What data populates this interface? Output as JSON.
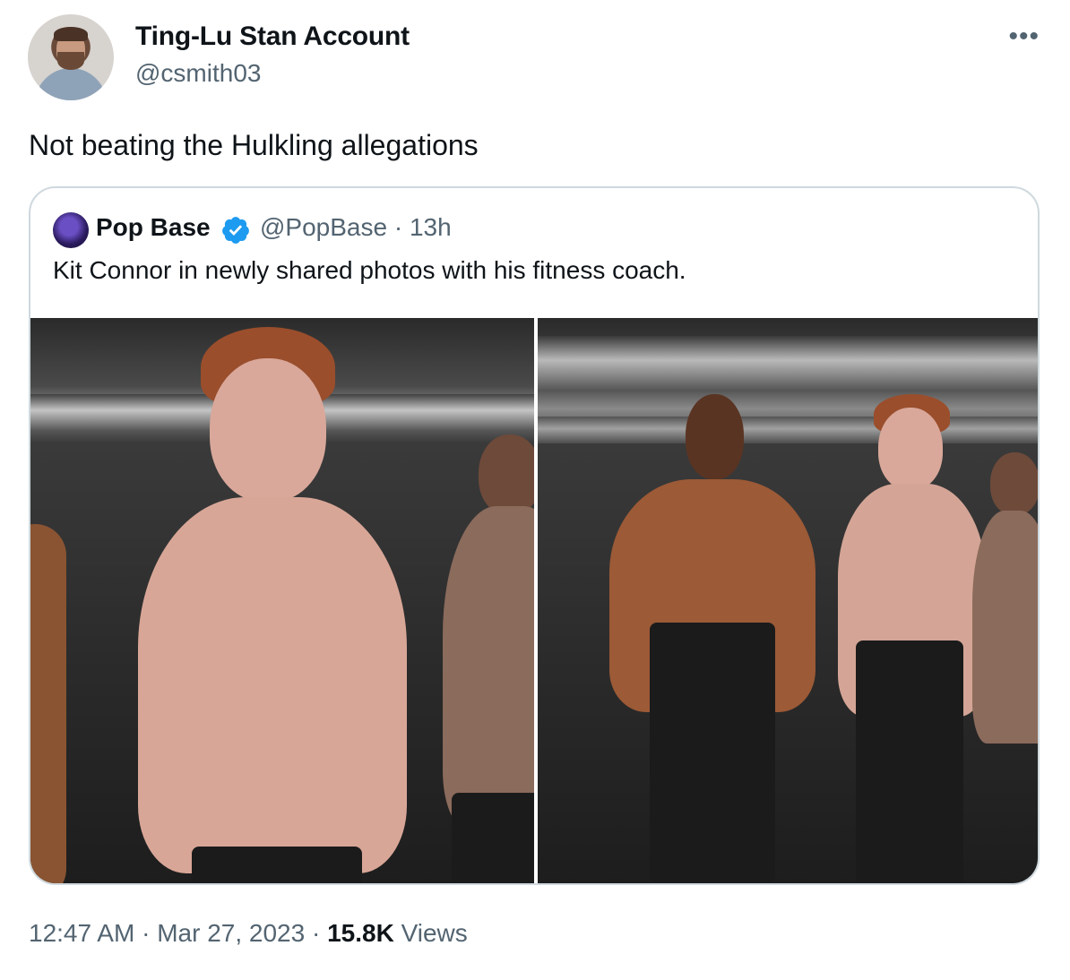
{
  "author": {
    "display_name": "Ting-Lu Stan Account",
    "handle": "@csmith03"
  },
  "more_icon": "more-options-icon",
  "tweet": {
    "text": "Not beating the Hulkling allegations"
  },
  "quoted_tweet": {
    "display_name": "Pop Base",
    "verified": true,
    "handle_time": "@PopBase · 13h",
    "text": "Kit Connor in newly shared photos with his fitness coach."
  },
  "footer": {
    "time": "12:47 AM",
    "separator": " · ",
    "date": "Mar 27, 2023",
    "views_count": "15.8K",
    "views_label": "Views"
  },
  "colors": {
    "text_primary": "#0f1419",
    "text_secondary": "#536471",
    "border": "#cfd9de",
    "verified_blue": "#1d9bf0"
  }
}
